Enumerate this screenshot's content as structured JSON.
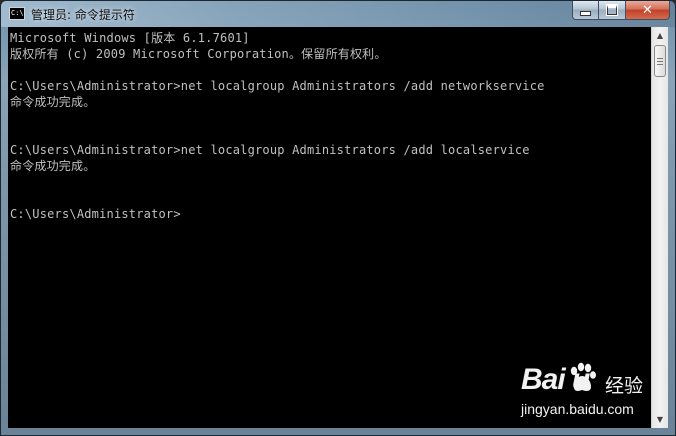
{
  "window": {
    "icon_text": "C:\\",
    "title": "管理员: 命令提示符",
    "minimize_icon": "minimize-icon",
    "maximize_icon": "maximize-icon",
    "close_icon": "close-icon",
    "close_glyph": "✕"
  },
  "console": {
    "lines": [
      "Microsoft Windows [版本 6.1.7601]",
      "版权所有 (c) 2009 Microsoft Corporation。保留所有权利。",
      "",
      "C:\\Users\\Administrator>net localgroup Administrators /add networkservice",
      "命令成功完成。",
      "",
      "",
      "C:\\Users\\Administrator>net localgroup Administrators /add localservice",
      "命令成功完成。",
      "",
      "",
      "C:\\Users\\Administrator>"
    ],
    "background_color": "#000000",
    "text_color": "#c0c0c0"
  },
  "scrollbar": {
    "up_glyph": "▲",
    "down_glyph": "▼"
  },
  "watermark": {
    "logo": "Bai  u",
    "name": "经验",
    "url": "jingyan.baidu.com"
  }
}
